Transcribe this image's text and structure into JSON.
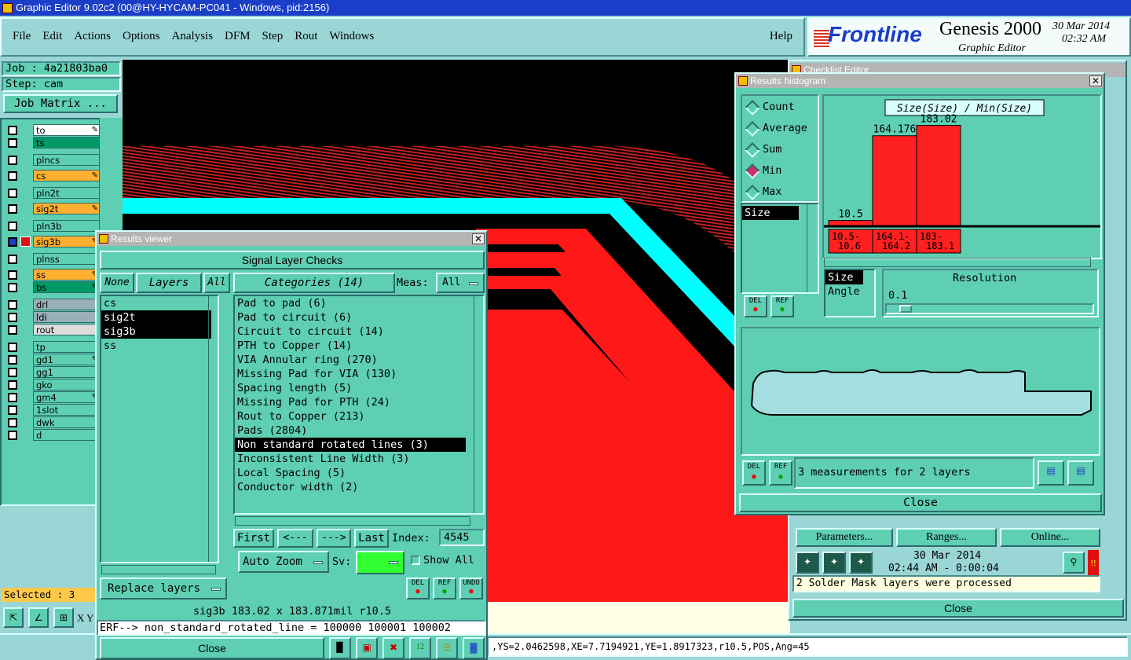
{
  "titlebar": {
    "title": "Graphic Editor 9.02c2 (00@HY-HYCAM-PC041 - Windows, pid:2156)"
  },
  "menu": [
    "File",
    "Edit",
    "Actions",
    "Options",
    "Analysis",
    "DFM",
    "Step",
    "Rout",
    "Windows"
  ],
  "help_label": "Help",
  "brand": {
    "logo": "Frontline",
    "product": "Genesis 2000",
    "subtitle": "Graphic Editor",
    "date": "30 Mar 2014",
    "time": "02:32 AM"
  },
  "job": {
    "job_label": "Job : 4a21803ba0",
    "step_label": "Step: cam",
    "matrix_button": "Job Matrix ..."
  },
  "layers": [
    {
      "name": "to",
      "color": "#ffffff",
      "pen": true,
      "active": false
    },
    {
      "name": "ts",
      "color": "#009966",
      "pen": false,
      "active": false
    },
    {
      "name": "plncs",
      "color": "#5ecfb3",
      "pen": false,
      "active": false
    },
    {
      "name": "cs",
      "color": "#ffb030",
      "pen": true,
      "active": false
    },
    {
      "name": "pln2t",
      "color": "#5ecfb3",
      "pen": false,
      "active": false
    },
    {
      "name": "sig2t",
      "color": "#ffb030",
      "pen": true,
      "active": false
    },
    {
      "name": "pln3b",
      "color": "#5ecfb3",
      "pen": false,
      "active": false
    },
    {
      "name": "sig3b",
      "color": "#ffb030",
      "pen": true,
      "active": true
    },
    {
      "name": "plnss",
      "color": "#5ecfb3",
      "pen": false,
      "active": false
    },
    {
      "name": "ss",
      "color": "#ffb030",
      "pen": true,
      "active": false
    },
    {
      "name": "bs",
      "color": "#009966",
      "pen": true,
      "active": false
    },
    {
      "name": "drl",
      "color": "#9ab0b8",
      "pen": false,
      "active": false
    },
    {
      "name": "ldi",
      "color": "#9ab0b8",
      "pen": false,
      "active": false
    },
    {
      "name": "rout",
      "color": "#dcdcdc",
      "pen": false,
      "active": false
    },
    {
      "name": "tp",
      "color": "#5ecfb3",
      "pen": false,
      "active": false
    },
    {
      "name": "gd1",
      "color": "#5ecfb3",
      "pen": true,
      "active": false
    },
    {
      "name": "gg1",
      "color": "#5ecfb3",
      "pen": false,
      "active": false
    },
    {
      "name": "gko",
      "color": "#5ecfb3",
      "pen": false,
      "active": false
    },
    {
      "name": "gm4",
      "color": "#5ecfb3",
      "pen": true,
      "active": false
    },
    {
      "name": "1slot",
      "color": "#5ecfb3",
      "pen": false,
      "active": false
    },
    {
      "name": "dwk",
      "color": "#5ecfb3",
      "pen": false,
      "active": false
    },
    {
      "name": "d",
      "color": "#5ecfb3",
      "pen": false,
      "active": false
    }
  ],
  "selected_label": "Selected : 3",
  "xy_label": "X Y",
  "status_coords": ",YS=2.0462598,XE=7.7194921,YE=1.8917323,r10.5,POS,Ang=45",
  "results_viewer": {
    "title": "Results viewer",
    "header": "Signal Layer Checks",
    "none_btn": "None",
    "layers_btn": "Layers",
    "all_btn": "All",
    "categories_btn": "Categories (14)",
    "meas_label": "Meas:",
    "meas_value": "All",
    "layers": [
      {
        "name": "cs",
        "selected": false
      },
      {
        "name": "sig2t",
        "selected": true
      },
      {
        "name": "sig3b",
        "selected": true
      },
      {
        "name": "ss",
        "selected": false
      }
    ],
    "categories": [
      {
        "name": "Pad to pad (6)",
        "selected": false
      },
      {
        "name": "Pad to circuit (6)",
        "selected": false
      },
      {
        "name": "Circuit to circuit (14)",
        "selected": false
      },
      {
        "name": "PTH to Copper (14)",
        "selected": false
      },
      {
        "name": "VIA Annular ring (270)",
        "selected": false
      },
      {
        "name": "Missing Pad for VIA (130)",
        "selected": false
      },
      {
        "name": "Spacing length (5)",
        "selected": false
      },
      {
        "name": "Missing Pad for PTH (24)",
        "selected": false
      },
      {
        "name": "Rout to Copper (213)",
        "selected": false
      },
      {
        "name": "Pads (2804)",
        "selected": false
      },
      {
        "name": "Non standard rotated lines (3)",
        "selected": true
      },
      {
        "name": "Inconsistent Line Width (3)",
        "selected": false
      },
      {
        "name": "Local Spacing (5)",
        "selected": false
      },
      {
        "name": "Conductor width (2)",
        "selected": false
      }
    ],
    "nav": {
      "first": "First",
      "prev": "<---",
      "next": "--->",
      "last": "Last",
      "index_label": "Index:",
      "index_value": "4545"
    },
    "auto_zoom": "Auto Zoom",
    "sv_label": "Sv:",
    "show_all": "Show All",
    "replace_layers": "Replace layers",
    "del": "DEL",
    "ref": "REF",
    "undo": "UNDO",
    "info": "sig3b 183.02 x 183.871mil  r10.5",
    "erf": "ERF--> non_standard_rotated_line = 100000 100001 100002",
    "close": "Close"
  },
  "histogram": {
    "title": "Results histogram",
    "options": [
      {
        "label": "Count",
        "on": false
      },
      {
        "label": "Average",
        "on": false
      },
      {
        "label": "Sum",
        "on": false
      },
      {
        "label": "Min",
        "on": true
      },
      {
        "label": "Max",
        "on": false
      }
    ],
    "attr_list": [
      "Size"
    ],
    "chart_title": "Size(Size) / Min(Size)",
    "param_list": [
      {
        "name": "Size",
        "selected": true
      },
      {
        "name": "Angle",
        "selected": false
      }
    ],
    "resolution_label": "Resolution",
    "resolution_value": "0.1",
    "del": "DEL",
    "ref": "REF",
    "measurements": "3 measurements for 2 layers",
    "close": "Close"
  },
  "chart_data": {
    "type": "bar",
    "title": "Size(Size) / Min(Size)",
    "categories": [
      "10.5-\n10.6",
      "164.1-\n164.2",
      "183-\n183.1"
    ],
    "values": [
      10.5,
      164.176,
      183.02
    ],
    "value_labels": [
      "10.5",
      "164.176",
      "183.02"
    ],
    "ylim": [
      0,
      200
    ],
    "color": "#ff2020"
  },
  "checklist": {
    "title": "Checklist Editor",
    "parameters": "Parameters...",
    "ranges": "Ranges...",
    "online": "Online...",
    "date": "30 Mar 2014",
    "time": "02:44 AM - 0:00:04",
    "message": "2 Solder Mask layers were processed",
    "close": "Close"
  }
}
